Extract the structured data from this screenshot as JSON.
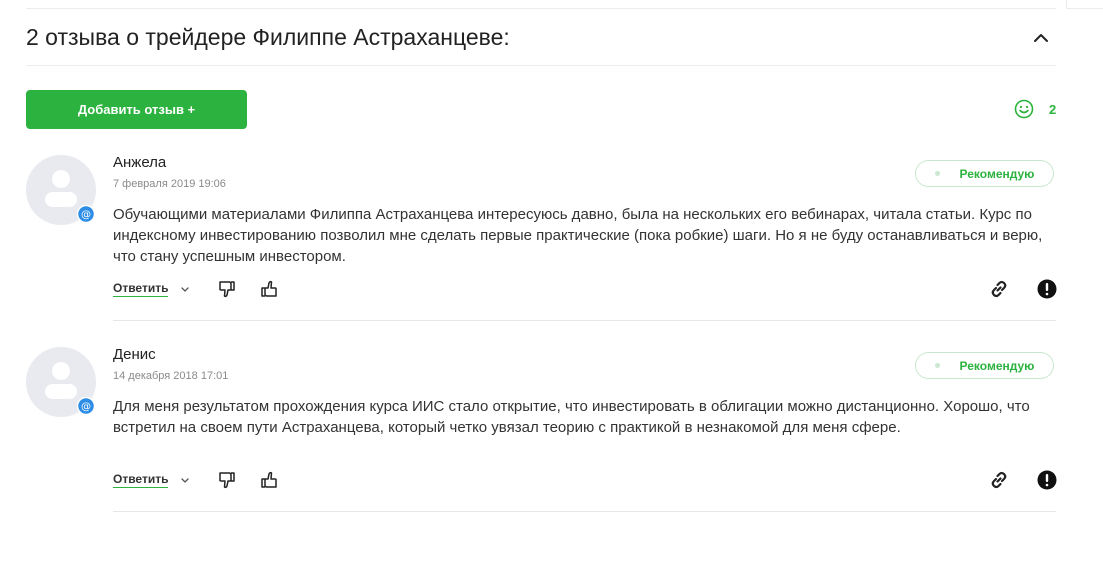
{
  "header": {
    "title": "2 отзыва о трейдере Филиппе Астраханцеве:"
  },
  "add_button": {
    "label": "Добавить отзыв +"
  },
  "rating": {
    "count": "2"
  },
  "reviews": [
    {
      "author": "Анжела",
      "date": "7 февраля 2019 19:06",
      "recommend_label": "Рекомендую",
      "text": "Обучающими материалами Филиппа Астраханцева интересуюсь давно, была на нескольких его вебинарах, читала статьи. Курс по индексному инвестированию позволил мне сделать первые практические (пока робкие) шаги. Но я не буду останавливаться и верю, что стану успешным инвестором.",
      "reply_label": "Ответить"
    },
    {
      "author": "Денис",
      "date": "14 декабря 2018 17:01",
      "recommend_label": "Рекомендую",
      "text": "Для меня результатом прохождения курса ИИС стало открытие, что инвестировать в облигации можно дистанционно. Хорошо, что встретил на своем пути Астраханцева, который четко увязал теорию с практикой в незнакомой для меня сфере.",
      "reply_label": "Ответить"
    }
  ],
  "colors": {
    "accent": "#2cb33f",
    "avatar_bg": "#e8eaef",
    "badge": "#2e8de6"
  }
}
